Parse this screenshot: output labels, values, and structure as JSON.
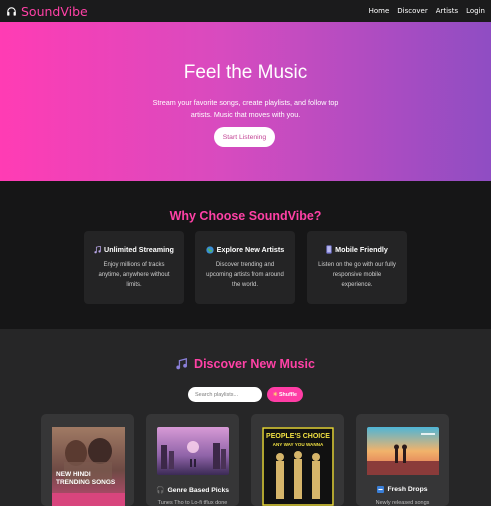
{
  "navbar": {
    "brand": "SoundVibe",
    "links": [
      "Home",
      "Discover",
      "Artists",
      "Login"
    ]
  },
  "hero": {
    "title": "Feel the Music",
    "subtitle": "Stream your favorite songs, create playlists, and follow top artists. Music that moves with you.",
    "cta": "Start Listening"
  },
  "why": {
    "title": "Why Choose SoundVibe?",
    "features": [
      {
        "icon": "music-note-icon",
        "title": "Unlimited Streaming",
        "text": "Enjoy millions of tracks anytime, anywhere without limits."
      },
      {
        "icon": "globe-icon",
        "title": "Explore New Artists",
        "text": "Discover trending and upcoming artists from around the world."
      },
      {
        "icon": "mobile-phone-icon",
        "title": "Mobile Friendly",
        "text": "Listen on the go with our fully responsive mobile experience."
      }
    ]
  },
  "discover": {
    "title": "Discover New Music",
    "search_placeholder": "Search playlists...",
    "shuffle_label": "Shuffle",
    "cards": [
      {
        "art_text_1": "NEW HINDI",
        "art_text_2": "TRENDING SONGS",
        "label": "",
        "desc": ""
      },
      {
        "label": "Genre Based Picks",
        "desc": "Tunes Tho to Lo-fi tflux done"
      },
      {
        "art_text_1": "PEOPLE'S CHOICE",
        "art_text_2": "ANY WAY YOU WANNA",
        "label": "",
        "desc": ""
      },
      {
        "label": "Fresh Drops",
        "desc": "Newly released songs"
      }
    ]
  },
  "colors": {
    "accent": "#ff41a6",
    "hero_start": "#ff3cb4",
    "hero_end": "#8f4dc3"
  }
}
